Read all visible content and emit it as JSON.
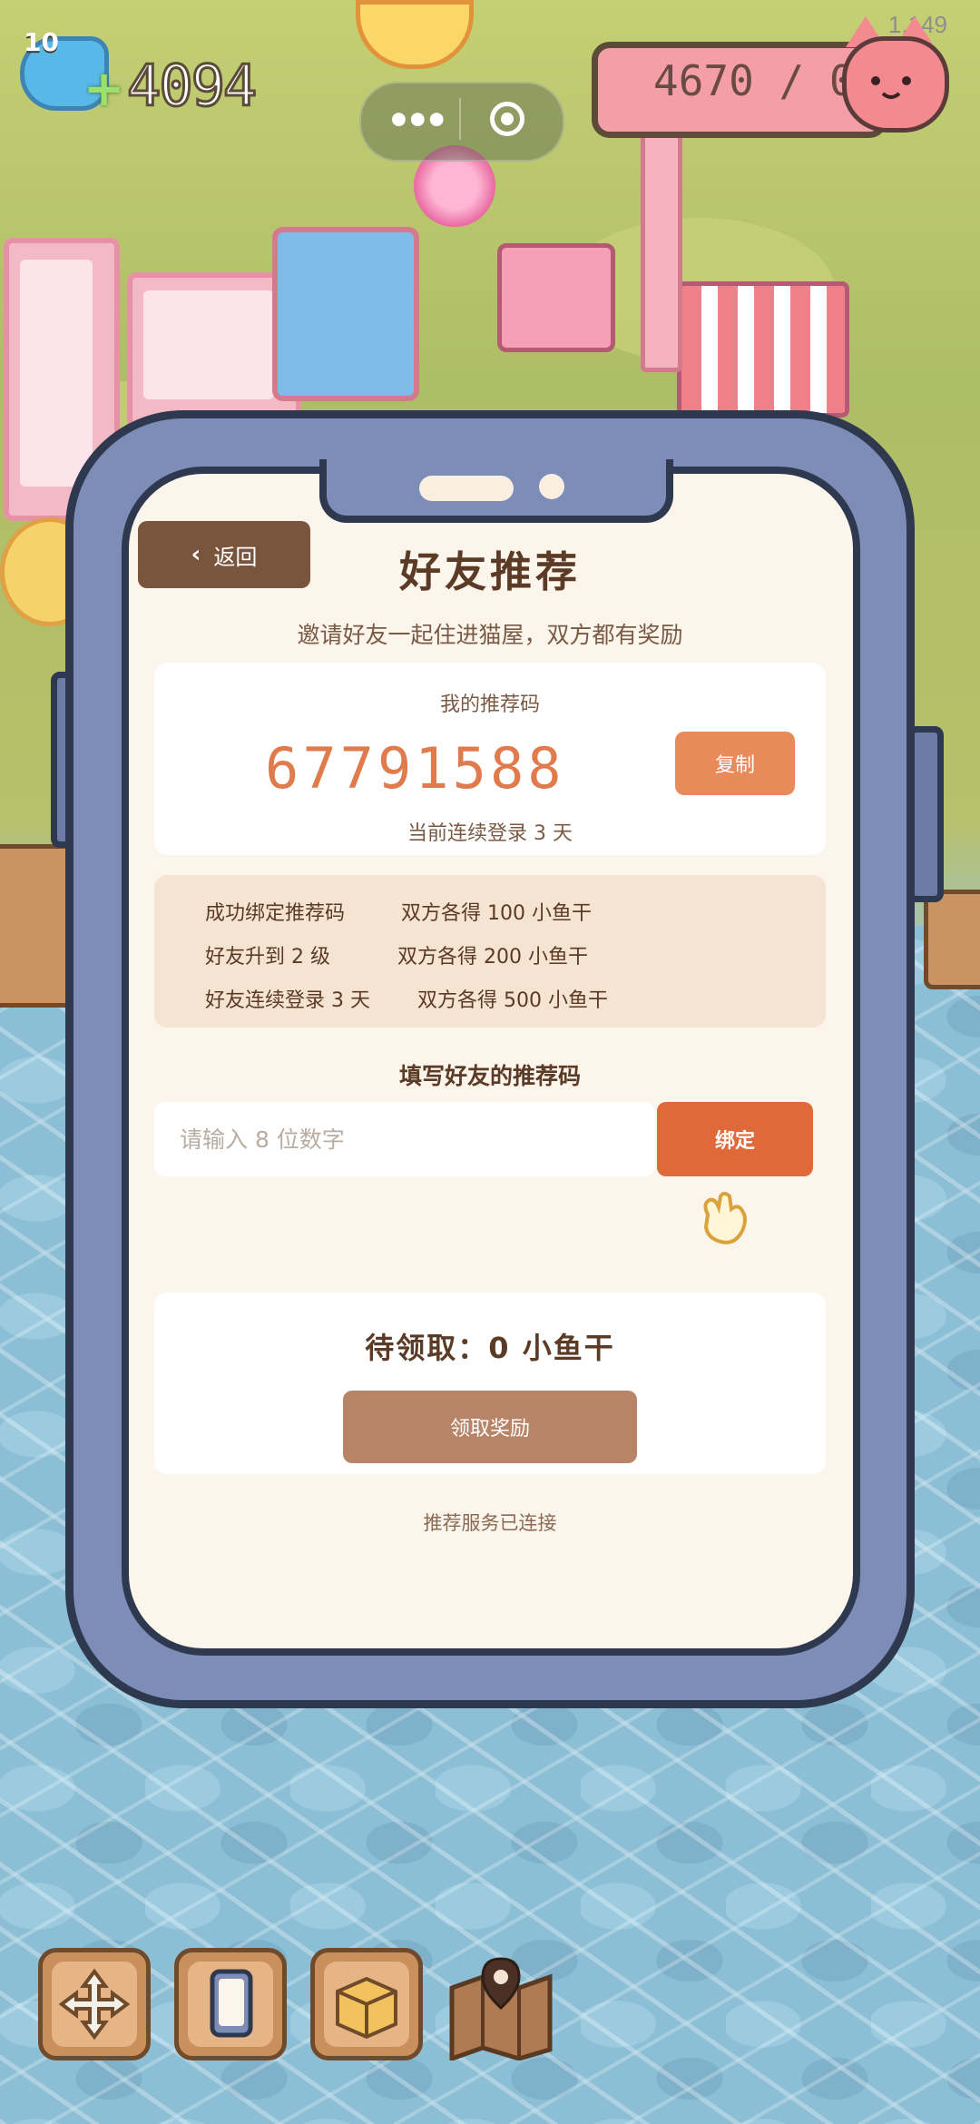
{
  "hud": {
    "level": "10",
    "plus": "+",
    "coins": "4094",
    "version": "1.149",
    "score": "4670 / 0"
  },
  "capsule": {
    "more_icon": "more-dots-icon",
    "close_icon": "target-icon"
  },
  "dialog": {
    "back_label": "返回",
    "title": "好友推荐",
    "subtitle": "邀请好友一起住进猫屋，双方都有奖励",
    "my_code_label": "我的推荐码",
    "my_code": "67791588",
    "copy_label": "复制",
    "streak_text": "当前连续登录 3 天",
    "rewards": [
      {
        "condition": "成功绑定推荐码",
        "reward": "双方各得 100 小鱼干"
      },
      {
        "condition": "好友升到 2 级",
        "reward": "双方各得 200 小鱼干"
      },
      {
        "condition": "好友连续登录 3 天",
        "reward": "双方各得 500 小鱼干"
      }
    ],
    "fill_label": "填写好友的推荐码",
    "input_value": "",
    "input_placeholder": "请输入 8 位数字",
    "bind_label": "绑定",
    "pending_text": "待领取：0 小鱼干",
    "claim_label": "领取奖励",
    "service_status": "推荐服务已连接"
  },
  "toolbar": {
    "items": [
      {
        "icon": "move-arrows-icon"
      },
      {
        "icon": "phone-icon"
      },
      {
        "icon": "box-icon"
      },
      {
        "icon": "map-icon"
      }
    ]
  },
  "colors": {
    "accent_orange": "#e0693a",
    "code_orange": "#e07b4d",
    "frame_blue": "#7e8db8",
    "brown": "#5b3a26"
  }
}
